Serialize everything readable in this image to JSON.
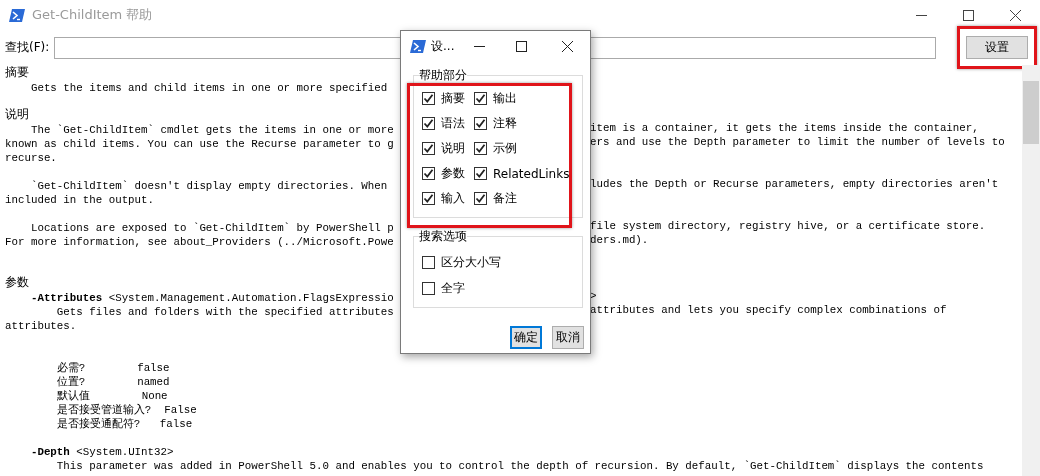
{
  "window": {
    "title": "Get-ChildItem 帮助"
  },
  "find": {
    "label": "查找(F):"
  },
  "settings_button": {
    "label": "设置",
    "highlighted": true
  },
  "help_lines": [
    {
      "kind": "heading",
      "text": "摘要"
    },
    {
      "kind": "code",
      "left": "    Gets the items and child items in one or more specified"
    },
    {
      "kind": "blank"
    },
    {
      "kind": "heading",
      "text": "说明"
    },
    {
      "kind": "code",
      "left": "    The `Get-ChildItem` cmdlet gets the items in one or more",
      "right": "item is a container, it gets the items inside the container,"
    },
    {
      "kind": "code",
      "left": "known as child items. You can use the Recurse parameter to g",
      "right": "ers and use the Depth parameter to limit the number of levels to"
    },
    {
      "kind": "code",
      "left": "recurse."
    },
    {
      "kind": "blank"
    },
    {
      "kind": "code",
      "left": "    `Get-ChildItem` doesn't display empty directories. When",
      "right": "ludes the Depth or Recurse parameters, empty directories aren't"
    },
    {
      "kind": "code",
      "left": "included in the output."
    },
    {
      "kind": "blank"
    },
    {
      "kind": "code",
      "left": "    Locations are exposed to `Get-ChildItem` by PowerShell p",
      "right": "file system directory, registry hive, or a certificate store."
    },
    {
      "kind": "code",
      "left": "For more information, see about_Providers (../Microsoft.Powe",
      "right": "ders.md)."
    },
    {
      "kind": "blank"
    },
    {
      "kind": "blank"
    },
    {
      "kind": "heading",
      "text": "参数"
    },
    {
      "kind": "code",
      "left": "    **-Attributes** <System.Management.Automation.FlagsExpressio",
      "right": ">"
    },
    {
      "kind": "code",
      "left": "        Gets files and folders with the specified attributes",
      "right": "attributes and lets you specify complex combinations of"
    },
    {
      "kind": "code",
      "left": "attributes."
    },
    {
      "kind": "blank"
    },
    {
      "kind": "blank"
    },
    {
      "kind": "code",
      "left": "        必需?        false"
    },
    {
      "kind": "code",
      "left": "        位置?        named"
    },
    {
      "kind": "code",
      "left": "        默认值        None"
    },
    {
      "kind": "code",
      "left": "        是否接受管道输入?  False"
    },
    {
      "kind": "code",
      "left": "        是否接受通配符?   false"
    },
    {
      "kind": "blank"
    },
    {
      "kind": "code",
      "left": "    **-Depth** <System.UInt32>"
    },
    {
      "kind": "code",
      "left": "        This parameter was added in PowerShell 5.0 and enables you to control the depth of recursion. By default, `Get-ChildItem` displays the contents"
    }
  ],
  "dialog": {
    "title": "设...",
    "groups": [
      {
        "title": "帮助部分",
        "kind": "grid",
        "highlighted": true,
        "options": [
          {
            "label": "摘要",
            "checked": true
          },
          {
            "label": "输出",
            "checked": true
          },
          {
            "label": "语法",
            "checked": true
          },
          {
            "label": "注释",
            "checked": true
          },
          {
            "label": "说明",
            "checked": true
          },
          {
            "label": "示例",
            "checked": true
          },
          {
            "label": "参数",
            "checked": true
          },
          {
            "label": "RelatedLinks",
            "checked": true
          },
          {
            "label": "输入",
            "checked": true
          },
          {
            "label": "备注",
            "checked": true
          }
        ]
      },
      {
        "title": "搜索选项",
        "kind": "list",
        "highlighted": false,
        "options": [
          {
            "label": "区分大小写",
            "checked": false
          },
          {
            "label": "全字",
            "checked": false
          }
        ]
      }
    ],
    "buttons": [
      {
        "label": "确定",
        "default": true
      },
      {
        "label": "取消",
        "default": false
      }
    ]
  }
}
